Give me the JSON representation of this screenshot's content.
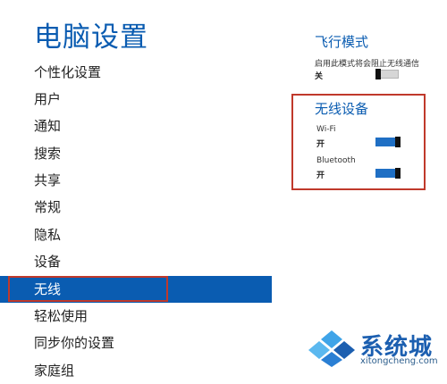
{
  "page": {
    "title": "电脑设置"
  },
  "nav": {
    "items": [
      {
        "label": "个性化设置"
      },
      {
        "label": "用户"
      },
      {
        "label": "通知"
      },
      {
        "label": "搜索"
      },
      {
        "label": "共享"
      },
      {
        "label": "常规"
      },
      {
        "label": "隐私"
      },
      {
        "label": "设备"
      },
      {
        "label": "无线"
      },
      {
        "label": "轻松使用"
      },
      {
        "label": "同步你的设置"
      },
      {
        "label": "家庭组"
      }
    ],
    "selected_label": "无线"
  },
  "airplane_mode": {
    "heading": "飞行模式",
    "description": "启用此模式将会阻止无线通信",
    "state_label": "关",
    "on": false
  },
  "wireless_devices": {
    "heading": "无线设备",
    "wifi": {
      "label": "Wi-Fi",
      "state_label": "开",
      "on": true
    },
    "bluetooth": {
      "label": "Bluetooth",
      "state_label": "开",
      "on": true
    }
  },
  "watermark": {
    "text": "系统城",
    "url": "xitongcheng.com",
    "colors": [
      "#2a7fd4",
      "#3fa4e8",
      "#1c5fb0",
      "#5bb8ef"
    ]
  },
  "colors": {
    "accent": "#0a5cb1",
    "highlight_outline": "#c0392b",
    "toggle_on": "#1f6fc4"
  }
}
